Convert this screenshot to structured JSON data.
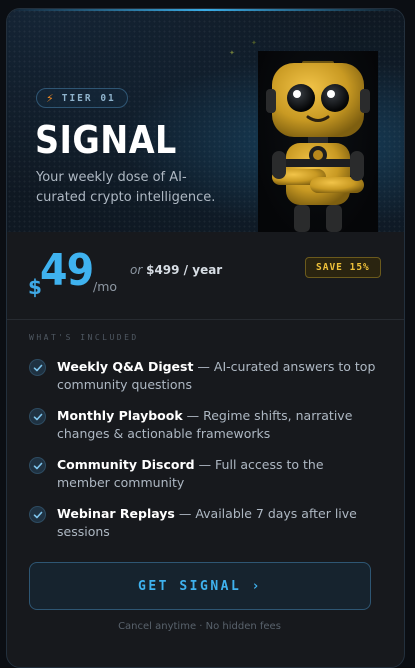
{
  "card": {
    "tier_badge": "TIER 01",
    "title": "SIGNAL",
    "description": "Your weekly dose of AI-curated crypto intelligence."
  },
  "pricing": {
    "currency": "$",
    "amount": "49",
    "period": "/mo",
    "or_label": "or",
    "annual": "$499 / year",
    "save_badge": "SAVE 15%"
  },
  "included": {
    "label": "WHAT'S INCLUDED",
    "features": [
      {
        "title": "Weekly Q&A Digest",
        "text": " — AI-curated answers to top community questions"
      },
      {
        "title": "Monthly Playbook",
        "text": " — Regime shifts, narrative changes & actionable frameworks"
      },
      {
        "title": "Community Discord",
        "text": " — Full access to the member community"
      },
      {
        "title": "Webinar Replays",
        "text": " — Available 7 days after live sessions"
      }
    ]
  },
  "cta": {
    "label": "GET SIGNAL ›"
  },
  "footnote": "Cancel anytime · No hidden fees",
  "colors": {
    "accent": "#3fb2ef",
    "save": "#f0c23a",
    "bolt": "#f08a24",
    "robot": "#d8a52a"
  },
  "icons": {
    "tier": "lightning-bolt-icon",
    "feature": "check-circle-icon",
    "mascot": "robot-mascot"
  }
}
